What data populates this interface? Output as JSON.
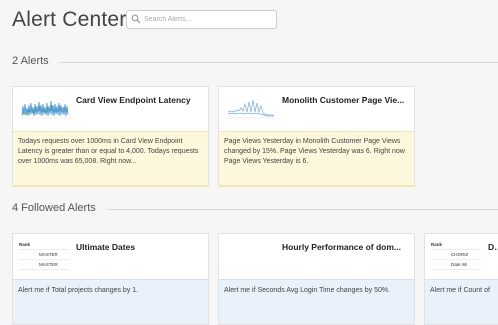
{
  "header": {
    "title": "Alert Center",
    "search_placeholder": "Search Alerts..."
  },
  "alerts_section": {
    "label": "2 Alerts",
    "cards": [
      {
        "title": "Card View Endpoint Latency",
        "description": "Todays requests over 1000ms in Card View Endpoint Latency is greater than or equal to 4,000. Todays requests over 1000ms was 65,008. Right now..."
      },
      {
        "title": "Monolith Customer Page Vie...",
        "description": "Page Views Yesterday in Monolith Customer Page Views changed by 15%. Page Views Yesterday was 6. Right now Page Views Yesterday is 6."
      }
    ]
  },
  "followed_section": {
    "label": "4 Followed Alerts",
    "cards": [
      {
        "title": "Ultimate Dates",
        "description": "Alert me if Total projects changes by 1.",
        "thumb": {
          "header": "Rank",
          "rows": [
            "MASTER",
            "MASTER"
          ]
        }
      },
      {
        "title": "Hourly Performance of dom...",
        "description": "Alert me if Seconds Avg Login Time changes by 50%."
      },
      {
        "title": "Do",
        "description": "Alert me if Count of",
        "thumb": {
          "header": "Rank",
          "rows": [
            "CHORIZ",
            "Date Wi"
          ]
        }
      }
    ]
  },
  "colors": {
    "alert_body": "#fdf7dc",
    "followed_body": "#e9f1fa",
    "sparkline_blue": "#3b8ed6",
    "sparkline_green": "#8bc34a"
  }
}
